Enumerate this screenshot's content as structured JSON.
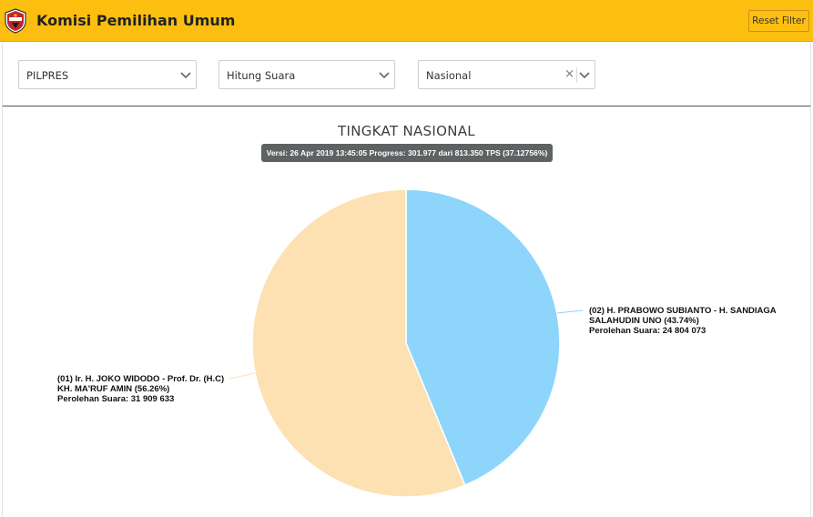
{
  "header": {
    "title": "Komisi Pemilihan Umum",
    "reset_label": "Reset Filter",
    "accent_color": "#fdbf0f"
  },
  "filters": [
    {
      "value": "PILPRES",
      "icon": "chevron-down-icon"
    },
    {
      "value": "Hitung Suara",
      "icon": "chevron-down-icon"
    },
    {
      "value": "Nasional",
      "icon": "chevron-down-icon",
      "clear_glyph": "×"
    }
  ],
  "chart_data": {
    "type": "pie",
    "title": "TINGKAT NASIONAL",
    "subtitle": "Versi: 26 Apr 2019 13:45:05 Progress: 301.977 dari 813.350 TPS (37.12756%)",
    "slices": [
      {
        "label_lines": [
          "(02) H. PRABOWO SUBIANTO - H. SANDIAGA",
          "SALAHUDIN UNO (43.74%)",
          "Perolehan Suara: 24 804 073"
        ],
        "percent": 43.74,
        "votes": 24804073,
        "color": "#8ed5fb"
      },
      {
        "label_lines": [
          "(01) Ir. H. JOKO WIDODO - Prof. Dr. (H.C)",
          "KH. MA'RUF AMIN (56.26%)",
          "Perolehan Suara: 31 909 633"
        ],
        "percent": 56.26,
        "votes": 31909633,
        "color": "#fde1b3"
      }
    ]
  }
}
